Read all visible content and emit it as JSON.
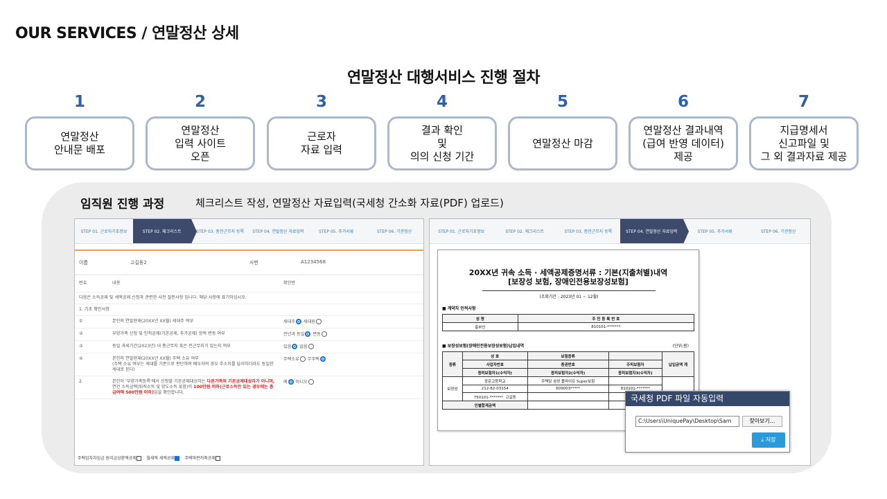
{
  "page_title": "OUR SERVICES / 연말정산 상세",
  "section_title": "연말정산 대행서비스 진행 절차",
  "steps": [
    {
      "num": "1",
      "label": "연말정산\n안내문 배포"
    },
    {
      "num": "2",
      "label": "연말정산\n입력 사이트\n오픈"
    },
    {
      "num": "3",
      "label": "근로자\n자료 입력"
    },
    {
      "num": "4",
      "label": "결과 확인\n및\n의의 신청 기간"
    },
    {
      "num": "5",
      "label": "연말정산 마감"
    },
    {
      "num": "6",
      "label": "연말정산 결과내역\n(급여 반영 데이터)\n제공"
    },
    {
      "num": "7",
      "label": "지급명세서\n신고파일 및\n그 외 결과자료 제공"
    }
  ],
  "panel": {
    "heading": "임직원 진행 과정",
    "subheading": "체크리스트 작성, 연말정산 자료입력(국세청 간소화 자료(PDF) 업로드)"
  },
  "shot1": {
    "stepbar": [
      "STEP 01. 근로자기초정보",
      "STEP 02. 체크리스트",
      "STEP 03. 종전근무지 등록",
      "STEP 04. 연말정산 자료입력",
      "STEP 05. 추가서류",
      "STEP 06. 기관정산"
    ],
    "name_label": "이름",
    "name_value": "고길동2",
    "emp_label": "사번",
    "emp_value": "A1234568",
    "col_no": "번호",
    "col_content": "내용",
    "col_check": "확인란",
    "intro": "다음은 소득공제 및 세액공제 신청과 관련한 사전 질문사항 입니다. 해당 사항에 표기하십시오.",
    "group1": "1. 기초 확인사항",
    "rows": [
      {
        "no": "①",
        "text": "본인의 연말현재(20XX년 XX월) 세대주 여부",
        "opt1": "세대주",
        "opt2": "세대원"
      },
      {
        "no": "②",
        "text": "부양가족 신청 및 인적공제(기본공제, 추가공제) 항목 변동 여부",
        "opt1": "전년과 동일",
        "opt2": "변동"
      },
      {
        "no": "③",
        "text": "동일 과세기간(2023년) 내 총근무지 혹은 전근무지가 있는지 여부",
        "opt1": "있음",
        "opt2": "없음"
      },
      {
        "no": "④",
        "text": "본인의 연말현재(20XX년 XX월) 주택 소유 여부\n(주택 소유 여부는 세대를 기준으로 판단하며 배우자의 경우 주소지를 달리하더라도 동일한 세대로 본다)",
        "opt1": "주택소유",
        "opt2": "무주택"
      }
    ],
    "row2_no": "2.",
    "row2_text_a": "본인이 '부양가족등록'에서 신청할 기본공제대상자는 ",
    "row2_red_a": "다른가족의 기본공제대상자가 아니며,",
    "row2_text_b": "연간 소득금액(퇴직소득 및 양도소득 포함)이 ",
    "row2_red_b": "100만원 이하(근로소득만 있는 경우에는 총급여액 500만원 이하)",
    "row2_text_c": "임을 확인합니다.",
    "row2_opt1": "예",
    "row2_opt2": "아니오",
    "foot": [
      "주택임차차입금 원리금상환액공제",
      "월세액 세액공제",
      "주택마련저축공제"
    ]
  },
  "shot2": {
    "stepbar": [
      "STEP 01. 근로자기초정보",
      "STEP 02. 체크리스트",
      "STEP 03. 종전근무지 등록",
      "STEP 04. 연말정산 자료입력",
      "STEP 05. 추가서류",
      "STEP 06. 기관정산"
    ],
    "doc_title_1": "20XX년 귀속 소득 · 세액공제증명서류 : 기본(지출처별)내역",
    "doc_title_2": "[보장성 보험, 장애인전용보장성보험]",
    "doc_period": "(조회기간 : 2023년 01 ~ 12월)",
    "sec1": "■ 계약자 인적사항",
    "t1_h1": "성 명",
    "t1_h2": "주 민 등 록 번 호",
    "t1_v1": "홍부인",
    "t1_v2": "810101-*******",
    "sec2": "■ 보장성보험(장애인전용보장성보험)납입내역",
    "unit": "(단위:원)",
    "t2": {
      "kind": "종류",
      "h_name": "상 호",
      "h_biz": "사업자번호",
      "h_insured1": "종피보험자1(수익자)",
      "h_type": "보험종류",
      "h_cert": "증권번호",
      "h_insured2": "종피보험자2(수익자)",
      "h_main": "주피보험자",
      "h_main2": "종피보험자3(수익자)",
      "h_amount": "납입금액 계",
      "r_kind": "보장성",
      "r_name": "광운고등학교",
      "r_biz": "212-82-03154",
      "r_ins1": "750101-*******",
      "r_ins1b": "고길동",
      "r_type": "주택담 삼성 플라이프 Super보험",
      "r_cert": "609003*****",
      "r_main": "810101-*******",
      "total": "인별합계금액"
    },
    "dialog_title": "국세청 PDF 파일 자동입력",
    "file_path": "C:\\Users\\UniquePay\\Desktop\\Sam",
    "browse": "찾아보기...",
    "save": "저장"
  }
}
